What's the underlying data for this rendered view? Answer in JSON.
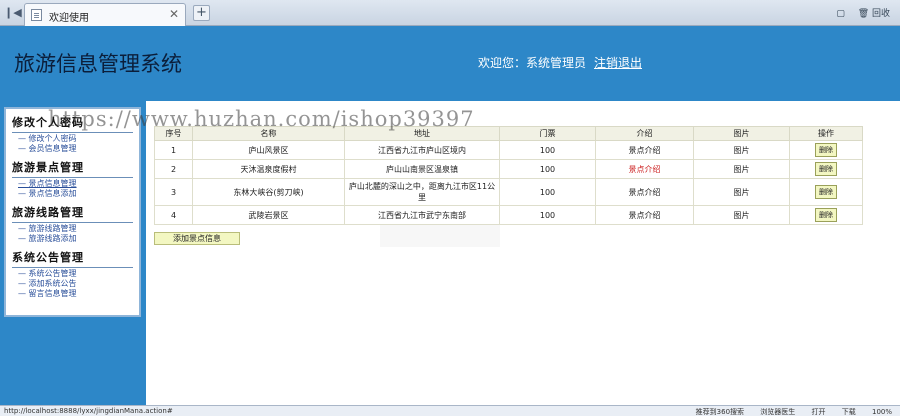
{
  "browser": {
    "tab_title": "欢迎使用",
    "tab_close": "✕",
    "new_tab": "+",
    "nav": "❙◀",
    "tools": [
      "▢",
      "🗑 回收"
    ]
  },
  "header": {
    "title": "旅游信息管理系统",
    "welcome": "欢迎您：系统管理员",
    "logout": "注销退出"
  },
  "sidebar": {
    "groups": [
      {
        "title": "修改个人密码",
        "items": [
          "修改个人密码",
          "会员信息管理"
        ]
      },
      {
        "title": "旅游景点管理",
        "items": [
          "景点信息管理",
          "景点信息添加"
        ]
      },
      {
        "title": "旅游线路管理",
        "items": [
          "旅游线路管理",
          "旅游线路添加"
        ]
      },
      {
        "title": "系统公告管理",
        "items": [
          "系统公告管理",
          "添加系统公告",
          "留言信息管理"
        ]
      }
    ]
  },
  "watermark": "https://www.huzhan.com/ishop39397",
  "table": {
    "headers": [
      "序号",
      "名称",
      "地址",
      "门票",
      "介绍",
      "图片",
      "操作"
    ],
    "rows": [
      {
        "id": "1",
        "name": "庐山风景区",
        "address": "江西省九江市庐山区境内",
        "ticket": "100",
        "intro": "景点介绍",
        "image": "图片",
        "action": "删除"
      },
      {
        "id": "2",
        "name": "天沐温泉度假村",
        "address": "庐山山南景区温泉镇",
        "ticket": "100",
        "intro": "景点介绍",
        "image": "图片",
        "action": "删除"
      },
      {
        "id": "3",
        "name": "东林大峡谷(剪刀峡)",
        "address": "庐山北麓的深山之中，距离九江市区11公里",
        "ticket": "100",
        "intro": "景点介绍",
        "image": "图片",
        "action": "删除"
      },
      {
        "id": "4",
        "name": "武陵岩景区",
        "address": "江西省九江市武宁东南部",
        "ticket": "100",
        "intro": "景点介绍",
        "image": "图片",
        "action": "删除"
      }
    ],
    "add_button": "添加景点信息"
  },
  "status": {
    "url": "http://localhost:8888/lyxx/jingdianMana.action#",
    "items": [
      "推荐到360搜索",
      "浏览器医生",
      "打开",
      "下载",
      "100%"
    ]
  }
}
